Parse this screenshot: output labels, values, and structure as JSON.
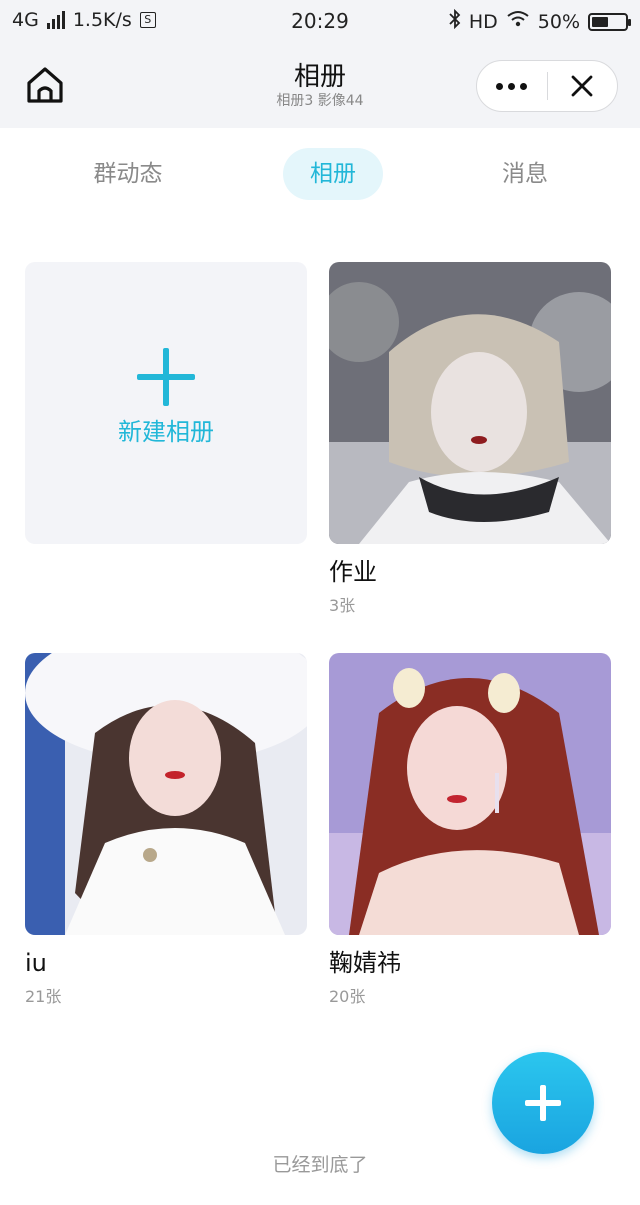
{
  "status_bar": {
    "network": "4G",
    "speed": "1.5K/s",
    "s_badge": "S",
    "time": "20:29",
    "hd": "HD",
    "battery_text": "50%",
    "battery_level": 0.5
  },
  "navbar": {
    "title": "相册",
    "subtitle": "相册3 影像44"
  },
  "tabs": [
    {
      "label": "群动态",
      "active": false
    },
    {
      "label": "相册",
      "active": true
    },
    {
      "label": "消息",
      "active": false
    }
  ],
  "new_album": {
    "label": "新建相册"
  },
  "albums": [
    {
      "name": "作业",
      "count": "3张"
    },
    {
      "name": "iu",
      "count": "21张"
    },
    {
      "name": "鞠婧祎",
      "count": "20张"
    }
  ],
  "footer": "已经到底了",
  "colors": {
    "accent": "#22b7d8",
    "fab": "#1aa4e0",
    "nav_bg": "#f3f4f7"
  }
}
